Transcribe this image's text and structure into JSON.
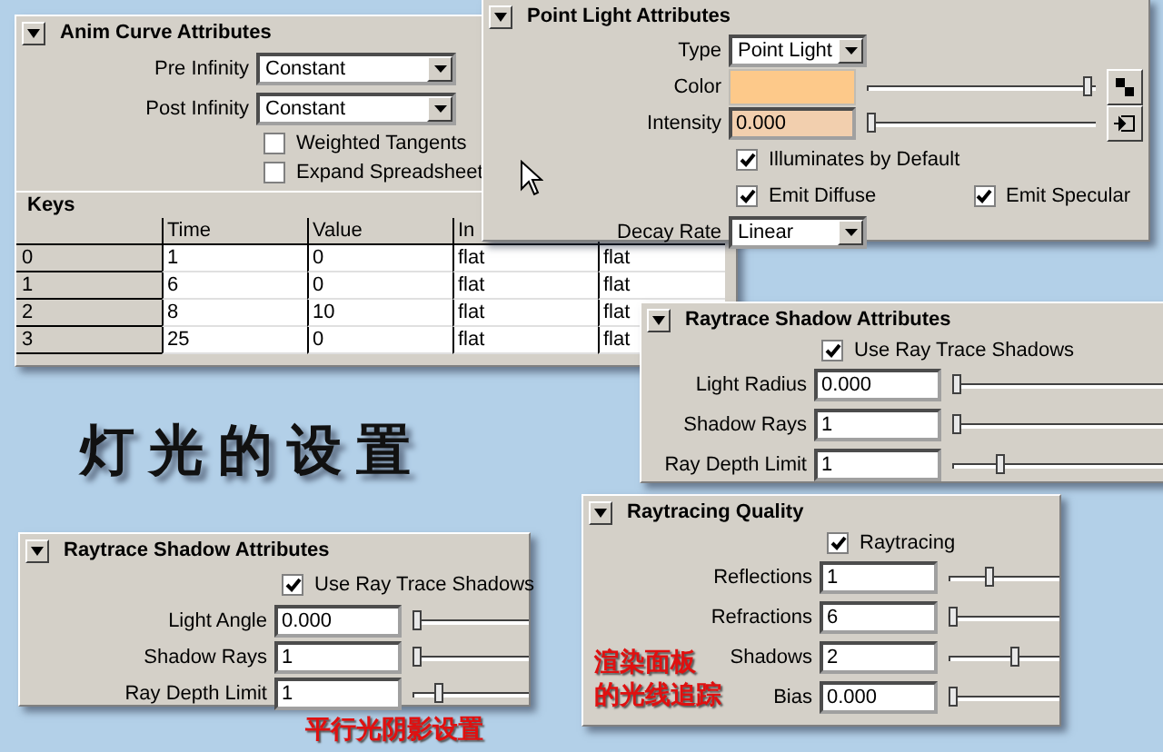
{
  "heading": "灯光的设置",
  "anim_curve_panel": {
    "title": "Anim Curve Attributes",
    "expanded": true,
    "rows": [
      {
        "kind": "dropdown",
        "label": "Pre Infinity",
        "value": "Constant"
      },
      {
        "kind": "dropdown",
        "label": "Post Infinity",
        "value": "Constant"
      },
      {
        "kind": "checkbox",
        "label": "Weighted Tangents",
        "checked": false
      },
      {
        "kind": "checkbox",
        "label": "Expand Spreadsheet",
        "checked": false
      }
    ],
    "keys_table": {
      "title": "Keys",
      "columns": [
        "Time",
        "Value",
        "In"
      ],
      "rows": [
        {
          "index": "0",
          "cells": [
            "1",
            "0",
            "flat",
            "flat"
          ]
        },
        {
          "index": "1",
          "cells": [
            "6",
            "0",
            "flat",
            "flat"
          ]
        },
        {
          "index": "2",
          "cells": [
            "8",
            "10",
            "flat",
            "flat"
          ]
        },
        {
          "index": "3",
          "cells": [
            "25",
            "0",
            "flat",
            "flat"
          ]
        }
      ]
    }
  },
  "point_light_panel": {
    "title": "Point Light Attributes",
    "expanded": true,
    "rows": [
      {
        "kind": "dropdown",
        "label": "Type",
        "value": "Point Light"
      },
      {
        "kind": "color",
        "label": "Color",
        "color": "#fdc98a",
        "level": 0.98
      },
      {
        "kind": "slider",
        "label": "Intensity",
        "value": "0.000",
        "level": 0,
        "color": "#f2cfae",
        "map_button": true
      },
      {
        "kind": "checkbox",
        "label": "Illuminates by Default",
        "checked": true
      },
      {
        "kind": "checkbox_pair",
        "items": [
          {
            "label": "Emit Diffuse",
            "checked": true
          },
          {
            "label": "Emit Specular",
            "checked": true
          }
        ]
      },
      {
        "kind": "dropdown",
        "label": "Decay Rate",
        "value": "Linear"
      }
    ]
  },
  "raytrace_shadow_panel_right": {
    "title": "Raytrace Shadow Attributes",
    "expanded": true,
    "rows": [
      {
        "kind": "checkbox",
        "label": "Use Ray Trace Shadows",
        "checked": true
      },
      {
        "kind": "slider",
        "label": "Light Radius",
        "value": "0.000",
        "level": 0
      },
      {
        "kind": "slider",
        "label": "Shadow Rays",
        "value": "1",
        "level": 0
      },
      {
        "kind": "slider",
        "label": "Ray Depth Limit",
        "value": "1",
        "level": 0.2
      }
    ]
  },
  "raytrace_shadow_panel_left": {
    "title": "Raytrace Shadow Attributes",
    "expanded": true,
    "rows": [
      {
        "kind": "checkbox",
        "label": "Use Ray Trace Shadows",
        "checked": true
      },
      {
        "kind": "slider",
        "label": "Light Angle",
        "value": "0.000",
        "level": 0
      },
      {
        "kind": "slider",
        "label": "Shadow Rays",
        "value": "1",
        "level": 0
      },
      {
        "kind": "slider",
        "label": "Ray Depth Limit",
        "value": "1",
        "level": 0.2
      }
    ],
    "caption": [
      "平行光阴影设置"
    ]
  },
  "raytracing_quality_panel": {
    "title": "Raytracing Quality",
    "expanded": true,
    "rows": [
      {
        "kind": "checkbox",
        "label": "Raytracing",
        "checked": true
      },
      {
        "kind": "slider",
        "label": "Reflections",
        "value": "1",
        "level": 0.35
      },
      {
        "kind": "slider",
        "label": "Refractions",
        "value": "6",
        "level": 0
      },
      {
        "kind": "slider",
        "label": "Shadows",
        "value": "2",
        "level": 0.6
      },
      {
        "kind": "slider",
        "label": "Bias",
        "value": "0.000",
        "level": 0
      }
    ],
    "caption": [
      "渲染面板",
      "的光线追踪"
    ]
  }
}
